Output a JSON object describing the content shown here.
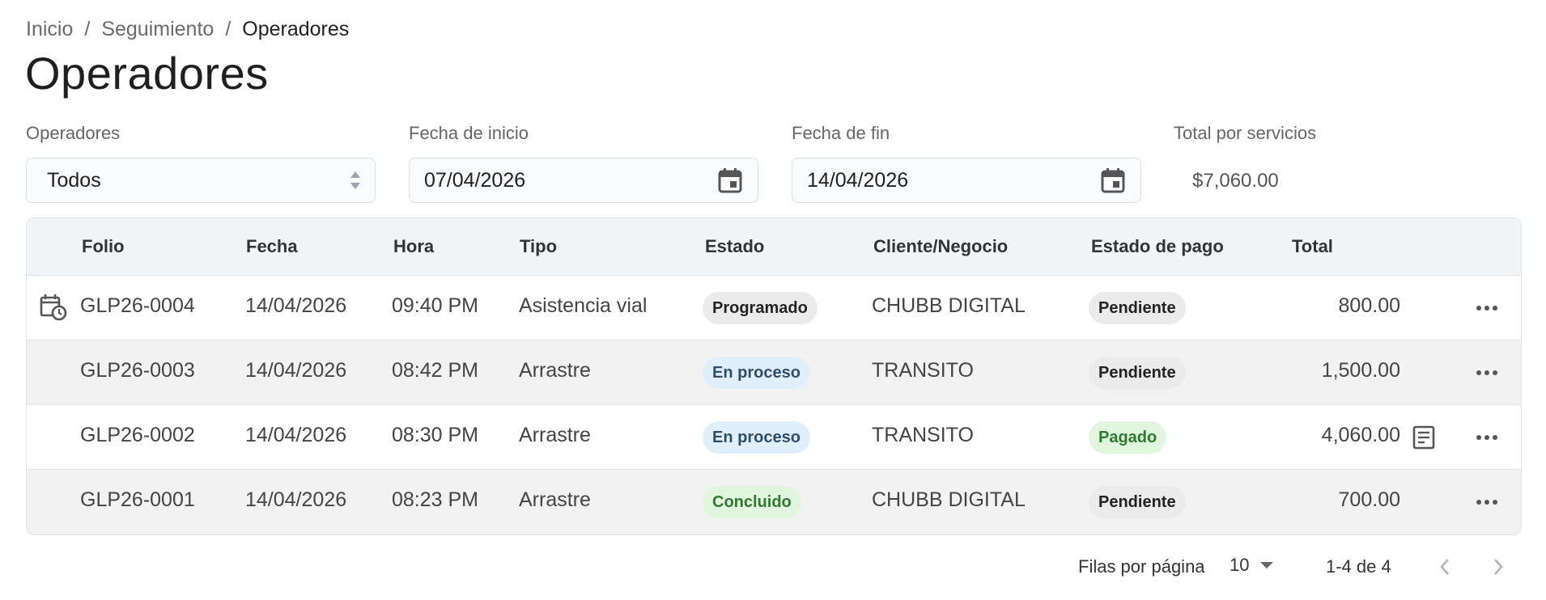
{
  "breadcrumb": {
    "items": [
      "Inicio",
      "Seguimiento",
      "Operadores"
    ],
    "separator": "/"
  },
  "page_title": "Operadores",
  "filters": {
    "operadores": {
      "label": "Operadores",
      "value": "Todos"
    },
    "fecha_inicio": {
      "label": "Fecha de inicio",
      "value": "07/04/2026"
    },
    "fecha_fin": {
      "label": "Fecha de fin",
      "value": "14/04/2026"
    },
    "total_servicios": {
      "label": "Total por servicios",
      "value": "$7,060.00"
    }
  },
  "table": {
    "columns": [
      "Folio",
      "Fecha",
      "Hora",
      "Tipo",
      "Estado",
      "Cliente/Negocio",
      "Estado de pago",
      "Total"
    ],
    "rows": [
      {
        "folio": "GLP26-0004",
        "fecha": "14/04/2026",
        "hora": "09:40 PM",
        "tipo": "Asistencia vial",
        "estado": "Programado",
        "cliente": "CHUBB DIGITAL",
        "pago": "Pendiente",
        "total": "800.00",
        "scheduled_icon": "calendar-clock-icon"
      },
      {
        "folio": "GLP26-0003",
        "fecha": "14/04/2026",
        "hora": "08:42 PM",
        "tipo": "Arrastre",
        "estado": "En proceso",
        "cliente": "TRANSITO",
        "pago": "Pendiente",
        "total": "1,500.00"
      },
      {
        "folio": "GLP26-0002",
        "fecha": "14/04/2026",
        "hora": "08:30 PM",
        "tipo": "Arrastre",
        "estado": "En proceso",
        "cliente": "TRANSITO",
        "pago": "Pagado",
        "total": "4,060.00",
        "receipt_icon": "receipt-icon"
      },
      {
        "folio": "GLP26-0001",
        "fecha": "14/04/2026",
        "hora": "08:23 PM",
        "tipo": "Arrastre",
        "estado": "Concluido",
        "cliente": "CHUBB DIGITAL",
        "pago": "Pendiente",
        "total": "700.00"
      }
    ]
  },
  "pagination": {
    "rows_per_page_label": "Filas por página",
    "rows_per_page_value": "10",
    "range": "1-4 de 4"
  },
  "colors": {
    "chip_gray": "#ebebeb",
    "chip_blue": "#e1effa",
    "chip_green": "#e2f5df",
    "header_bg": "#f1f5f8",
    "alt_row_bg": "#f2f2f2"
  }
}
